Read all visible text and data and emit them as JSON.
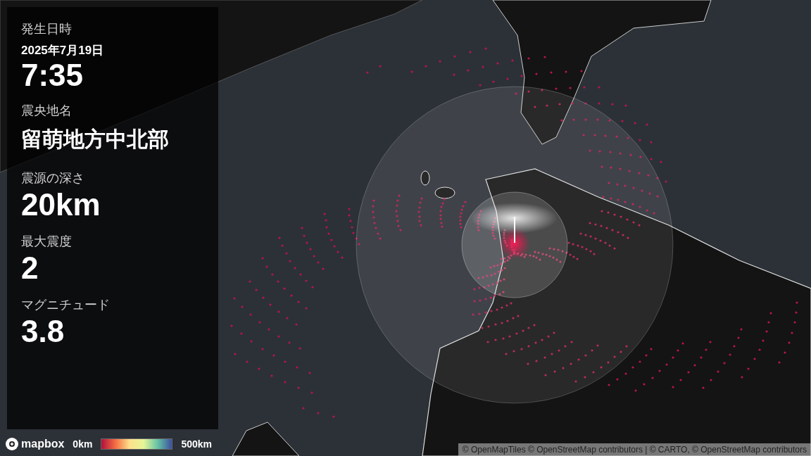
{
  "info_panel": {
    "fields": [
      {
        "kind": "datetime",
        "label": "発生日時",
        "date": "2025年7月19日",
        "value": "7:35"
      },
      {
        "kind": "place",
        "label": "震央地名",
        "value": "留萌地方中北部"
      },
      {
        "kind": "number",
        "label": "震源の深さ",
        "value": "20km"
      },
      {
        "kind": "number",
        "label": "最大震度",
        "value": "2"
      },
      {
        "kind": "number",
        "label": "マグニチュード",
        "value": "3.8"
      }
    ]
  },
  "logo": "mapbox",
  "legend": {
    "min": "0km",
    "max": "500km"
  },
  "attribution": "© OpenMapTiles © OpenStreetMap contributors | © CARTO, © OpenStreetMap contributors"
}
